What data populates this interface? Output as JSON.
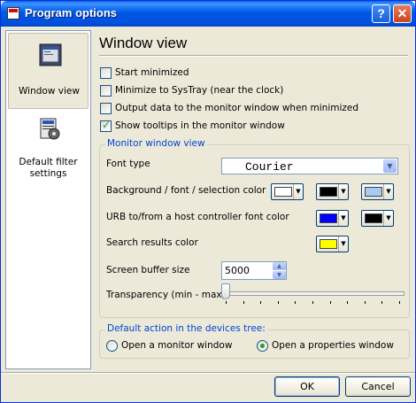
{
  "window": {
    "title": "Program options"
  },
  "titlebar": {
    "help_glyph": "?",
    "close_glyph": "✕"
  },
  "nav": {
    "items": [
      {
        "label": "Window view",
        "icon": "monitor-window-icon",
        "selected": true
      },
      {
        "label": "Default filter settings",
        "icon": "filter-settings-icon",
        "selected": false
      }
    ]
  },
  "page": {
    "title": "Window view",
    "checkboxes": [
      {
        "label": "Start minimized",
        "checked": false
      },
      {
        "label": "Minimize to SysTray (near the clock)",
        "checked": false
      },
      {
        "label": "Output data to the monitor window when minimized",
        "checked": false
      },
      {
        "label": "Show tooltips in the monitor window",
        "checked": true
      }
    ],
    "monitor_group": {
      "title": "Monitor window view",
      "font_type_label": "Font type",
      "font_type_value": "Courier",
      "bg_font_sel_label": "Background / font / selection color",
      "bg_font_sel_colors": [
        "#ffffff",
        "#000000",
        "#a6cbf5"
      ],
      "urb_label": "URB to/from a host controller font color",
      "urb_colors": [
        "#0000ff",
        "#000000"
      ],
      "search_label": "Search results color",
      "search_color": "#ffff00",
      "buffer_label": "Screen buffer size",
      "buffer_value": "5000",
      "transparency_label": "Transparency (min - max)",
      "transparency_level": 0
    },
    "default_action_group": {
      "title": "Default action in the devices tree:",
      "options": [
        {
          "label": "Open a monitor window",
          "selected": false
        },
        {
          "label": "Open a properties window",
          "selected": true
        }
      ]
    }
  },
  "buttons": {
    "ok": "OK",
    "cancel": "Cancel"
  }
}
